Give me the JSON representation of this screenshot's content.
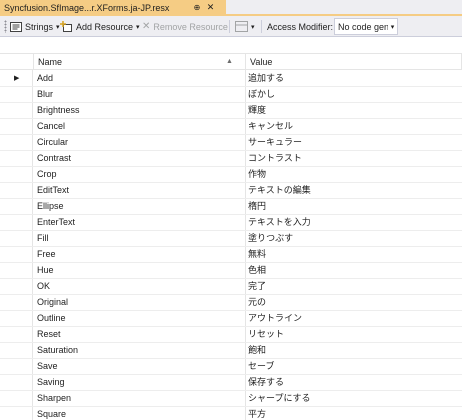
{
  "tab": {
    "title": "Syncfusion.SfImage...r.XForms.ja-JP.resx",
    "pin_icon": "pin-icon",
    "close_icon": "close-icon"
  },
  "toolbar": {
    "strings_label": "Strings",
    "add_resource_label": "Add Resource",
    "remove_resource_label": "Remove Resource",
    "access_modifier_label": "Access Modifier:",
    "access_modifier_value": "No code gene"
  },
  "grid": {
    "columns": [
      "Name",
      "Value"
    ],
    "rows": [
      {
        "name": "Add",
        "value": "追加する"
      },
      {
        "name": "Blur",
        "value": "ぼかし"
      },
      {
        "name": "Brightness",
        "value": "輝度"
      },
      {
        "name": "Cancel",
        "value": "キャンセル"
      },
      {
        "name": "Circular",
        "value": "サーキュラー"
      },
      {
        "name": "Contrast",
        "value": "コントラスト"
      },
      {
        "name": "Crop",
        "value": "作物"
      },
      {
        "name": "EditText",
        "value": "テキストの編集"
      },
      {
        "name": "Ellipse",
        "value": "楕円"
      },
      {
        "name": "EnterText",
        "value": "テキストを入力"
      },
      {
        "name": "Fill",
        "value": "塗りつぶす"
      },
      {
        "name": "Free",
        "value": "無料"
      },
      {
        "name": "Hue",
        "value": "色相"
      },
      {
        "name": "OK",
        "value": "完了"
      },
      {
        "name": "Original",
        "value": "元の"
      },
      {
        "name": "Outline",
        "value": "アウトライン"
      },
      {
        "name": "Reset",
        "value": "リセット"
      },
      {
        "name": "Saturation",
        "value": "飽和"
      },
      {
        "name": "Save",
        "value": "セーブ"
      },
      {
        "name": "Saving",
        "value": "保存する"
      },
      {
        "name": "Sharpen",
        "value": "シャープにする"
      },
      {
        "name": "Square",
        "value": "平方"
      }
    ]
  }
}
